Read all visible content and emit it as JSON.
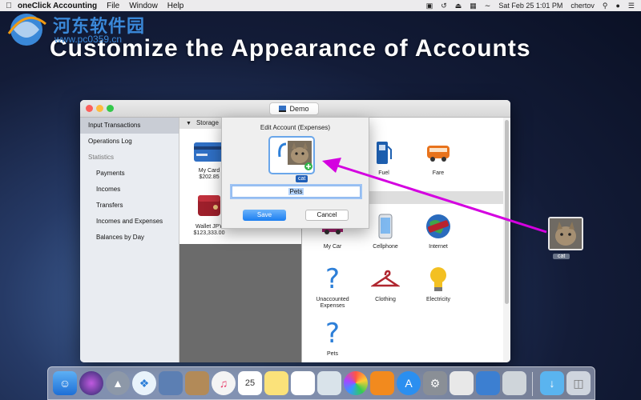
{
  "menubar": {
    "app_name": "oneClick Accounting",
    "menus": [
      "File",
      "Window",
      "Help"
    ],
    "date_time": "Sat Feb 25  1:01 PM",
    "user": "chertov"
  },
  "watermark": {
    "site_name_cn": "河东软件园",
    "url": "www.pc0359.cn"
  },
  "headline": "Customize the Appearance of Accounts",
  "window": {
    "document_name": "Demo",
    "sidebar": {
      "items": [
        {
          "label": "Input Transactions",
          "active": true
        },
        {
          "label": "Operations Log"
        },
        {
          "label": "Statistics",
          "header": true
        },
        {
          "label": "Payments",
          "sub": true
        },
        {
          "label": "Incomes",
          "sub": true
        },
        {
          "label": "Transfers",
          "sub": true
        },
        {
          "label": "Incomes and Expenses",
          "sub": true
        },
        {
          "label": "Balances by Day",
          "sub": true
        }
      ]
    },
    "storage": {
      "header": "Storage",
      "accounts": [
        {
          "name": "My Card",
          "balance": "$202.85"
        },
        {
          "name": "Wallet JPY",
          "balance": "$123,333.00"
        }
      ]
    },
    "expenses": {
      "top_row": [
        "Fuel",
        "Fare"
      ],
      "items": [
        "My Car",
        "Cellphone",
        "Internet",
        "Unaccounted Expenses",
        "Clothing",
        "Electricity",
        "Pets"
      ]
    }
  },
  "dialog": {
    "title": "Edit Account (Expenses)",
    "icon_label": "cat",
    "name_value": "Pets",
    "save_label": "Save",
    "cancel_label": "Cancel"
  },
  "desktop": {
    "file_label": "cat"
  },
  "colors": {
    "arrow": "#d400e0",
    "accent": "#1b7ef1"
  }
}
